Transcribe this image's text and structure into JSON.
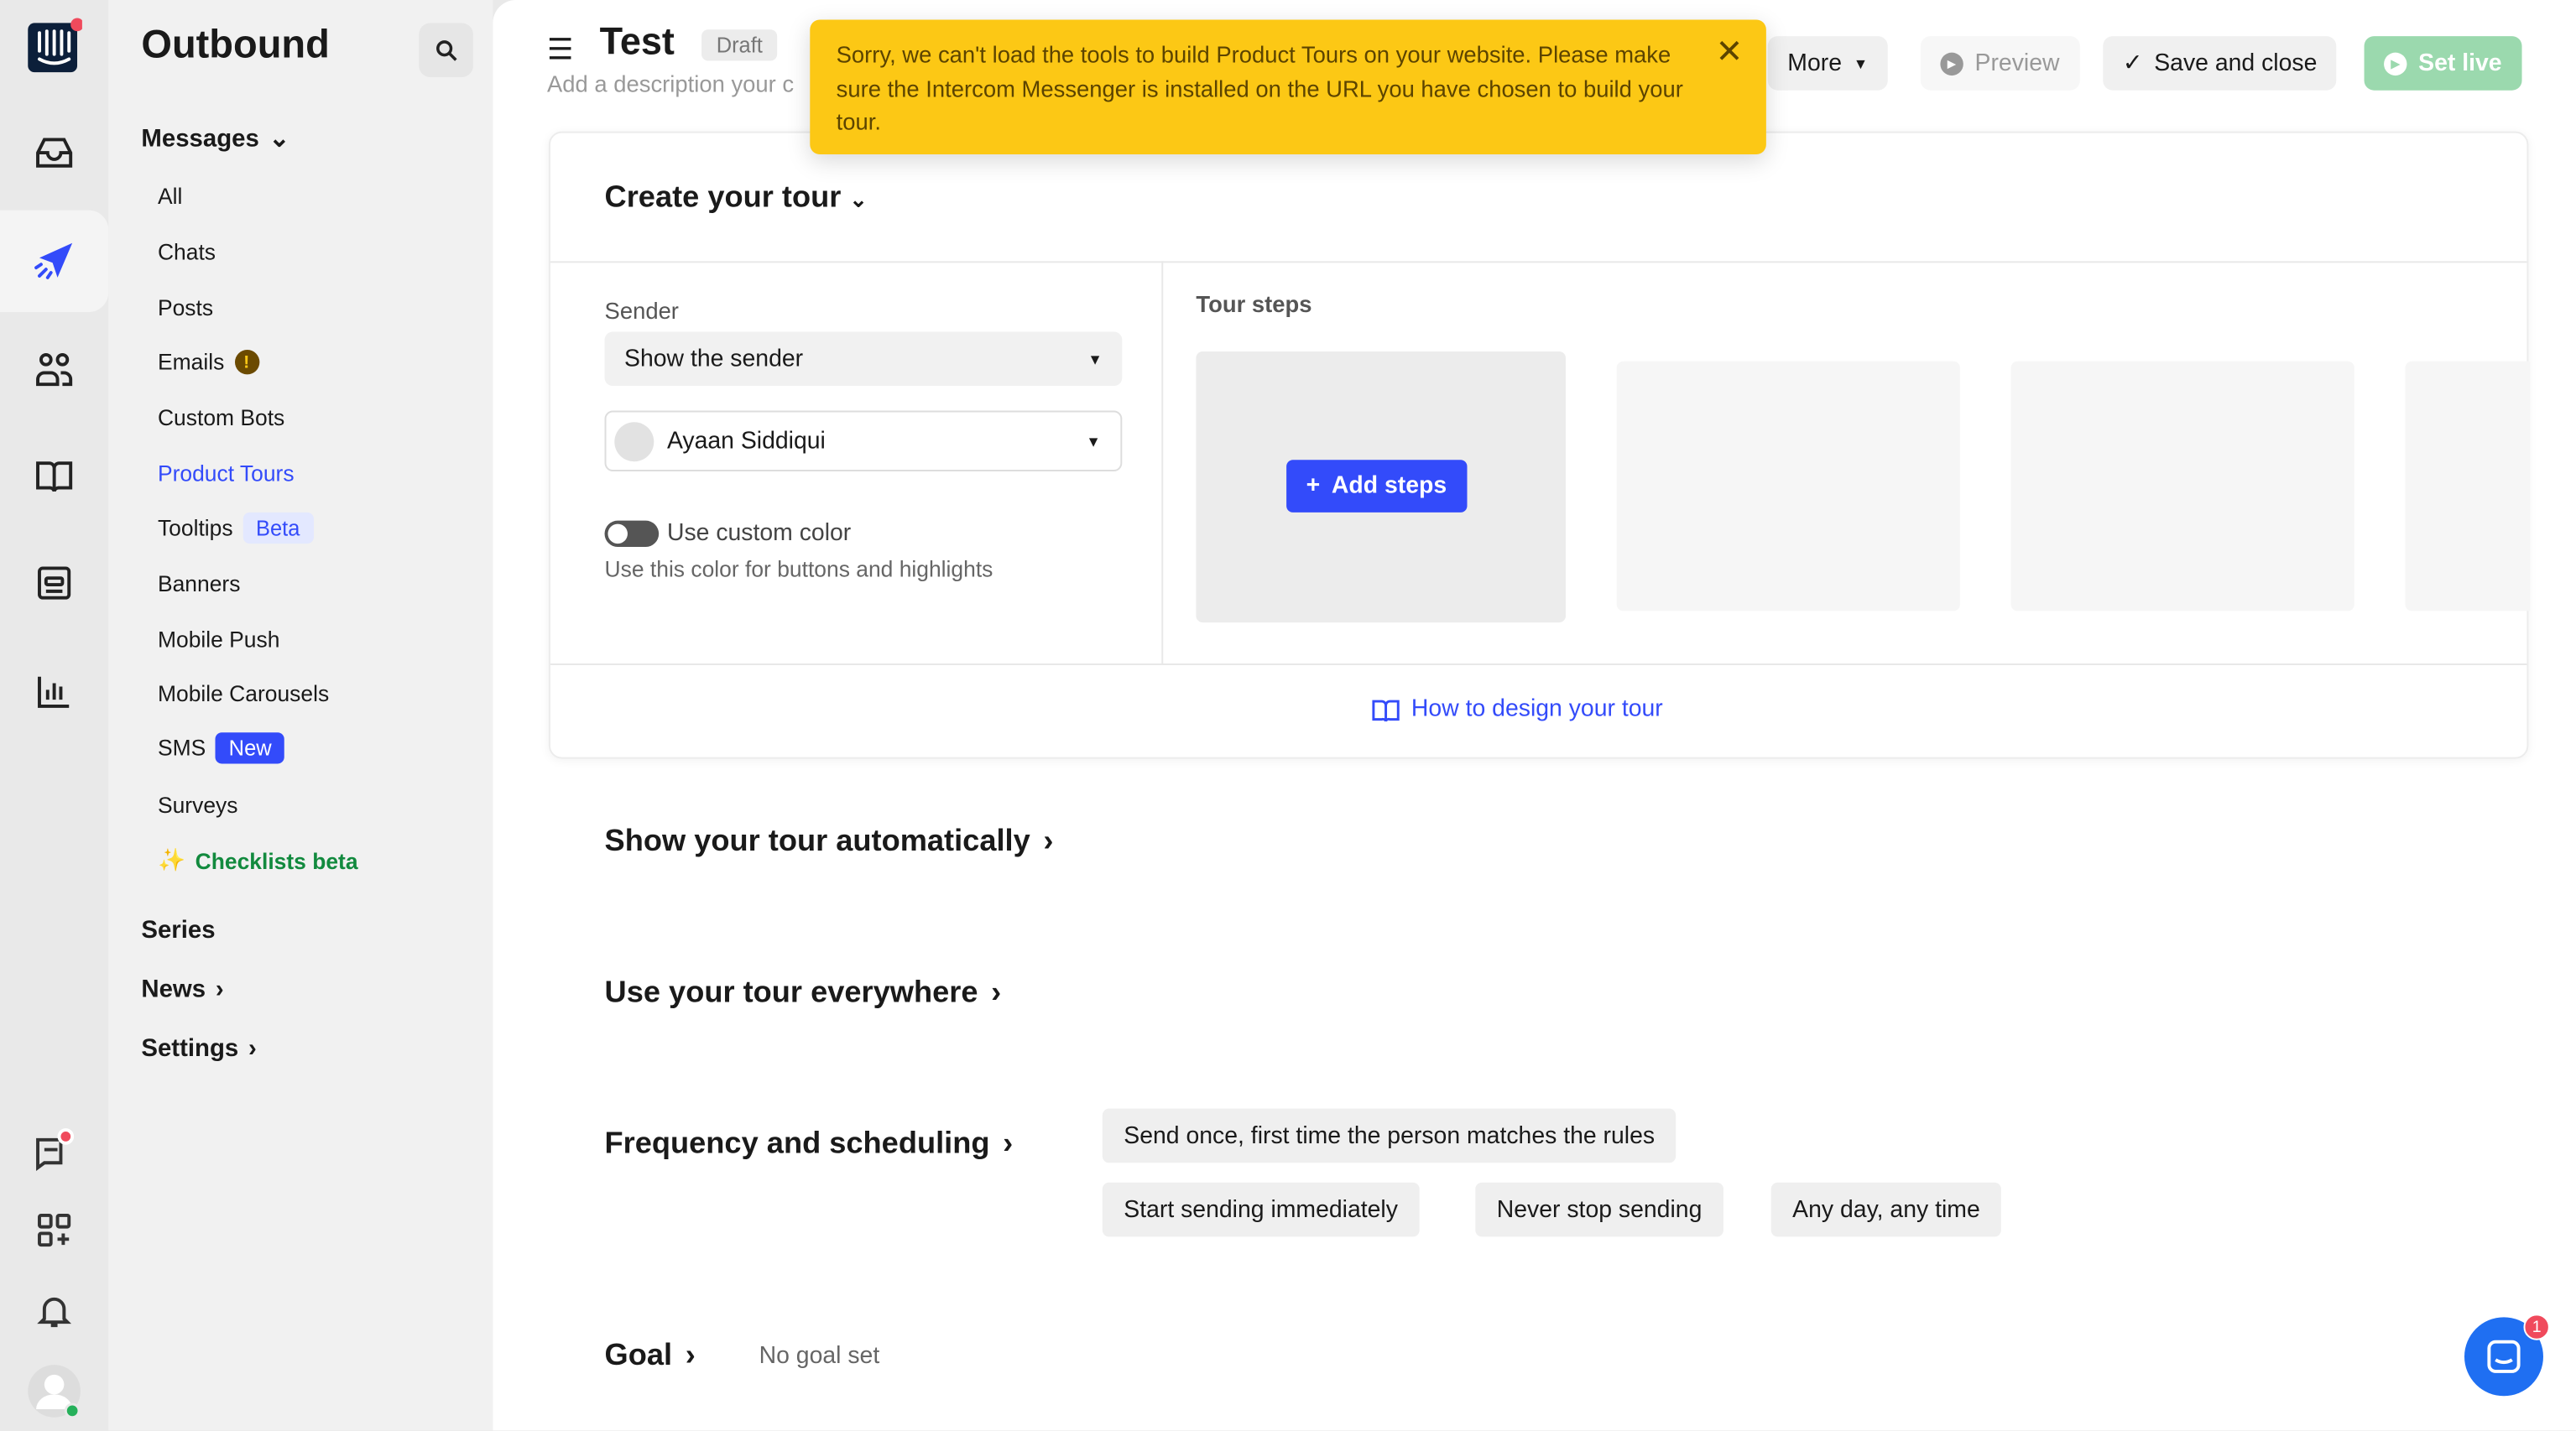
{
  "rail": {
    "items": [
      "inbox",
      "outbound",
      "contacts",
      "articles",
      "reports",
      "analytics"
    ],
    "bottom": [
      "messages-notification",
      "apps",
      "notifications",
      "avatar"
    ]
  },
  "sidebar": {
    "title": "Outbound",
    "messages_label": "Messages",
    "items": [
      {
        "label": "All"
      },
      {
        "label": "Chats"
      },
      {
        "label": "Posts"
      },
      {
        "label": "Emails"
      },
      {
        "label": "Custom Bots"
      },
      {
        "label": "Product Tours"
      },
      {
        "label": "Tooltips",
        "badge": "Beta"
      },
      {
        "label": "Banners"
      },
      {
        "label": "Mobile Push"
      },
      {
        "label": "Mobile Carousels"
      },
      {
        "label": "SMS",
        "badge": "New"
      },
      {
        "label": "Surveys"
      },
      {
        "label": "Checklists beta"
      }
    ],
    "groups": [
      "Series",
      "News",
      "Settings"
    ]
  },
  "header": {
    "title": "Test",
    "status": "Draft",
    "description_placeholder": "Add a description your c",
    "more": "More",
    "preview": "Preview",
    "save": "Save and close",
    "set_live": "Set live"
  },
  "toast": {
    "message": "Sorry, we can't load the tools to build Product Tours on your website. Please make sure the Intercom Messenger is installed on the URL you have chosen to build your tour."
  },
  "create": {
    "title": "Create your tour",
    "sender_label": "Sender",
    "sender_select": "Show the sender",
    "sender_name": "Ayaan Siddiqui",
    "custom_color_label": "Use custom color",
    "custom_color_help": "Use this color for buttons and highlights",
    "custom_color_on": false,
    "tour_steps_label": "Tour steps",
    "add_steps": "Add steps",
    "help_link": "How to design your tour"
  },
  "sections": {
    "show_auto": "Show your tour automatically",
    "use_everywhere": "Use your tour everywhere",
    "frequency": "Frequency and scheduling",
    "goal": "Goal",
    "goal_value": "No goal set"
  },
  "frequency_pills": [
    "Send once, first time the person matches the rules",
    "Start sending immediately",
    "Never stop sending",
    "Any day, any time"
  ],
  "messenger": {
    "badge": "1"
  },
  "colors": {
    "accent": "#334bfa",
    "toast": "#fcc815",
    "set_live": "#9bd9ae",
    "checklists": "#128a3e"
  }
}
